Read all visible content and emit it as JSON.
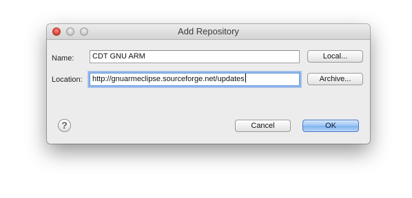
{
  "window": {
    "title": "Add Repository"
  },
  "form": {
    "name_label": "Name:",
    "name_value": "CDT GNU ARM",
    "location_label": "Location:",
    "location_value": "http://gnuarmeclipse.sourceforge.net/updates"
  },
  "buttons": {
    "local": "Local...",
    "archive": "Archive...",
    "cancel": "Cancel",
    "ok": "OK",
    "help_glyph": "?"
  },
  "icons": {
    "close": "close-icon",
    "minimize": "minimize-icon",
    "zoom": "zoom-icon",
    "help": "help-icon"
  },
  "colors": {
    "window_bg": "#ececec",
    "default_button": "#8fbcf1",
    "close_button": "#e0443a"
  }
}
